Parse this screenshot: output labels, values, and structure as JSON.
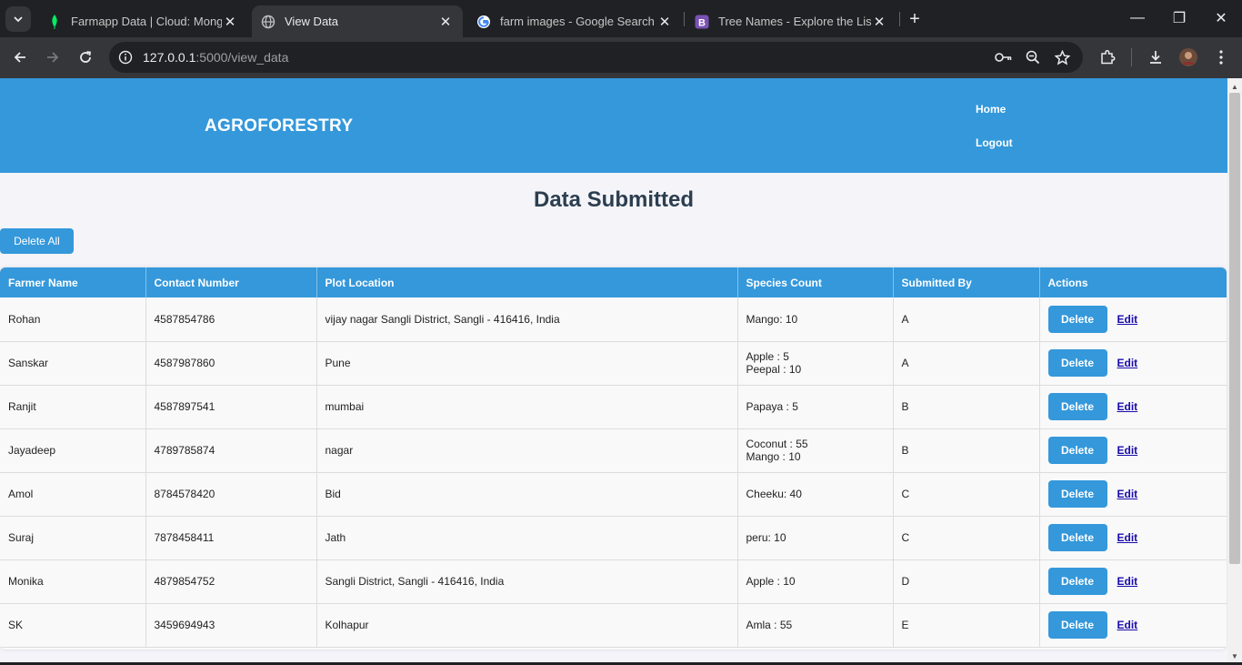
{
  "browser": {
    "tabs": [
      {
        "title": "Farmapp Data | Cloud: MongoDB",
        "icon": "mongodb-leaf-icon",
        "active": false
      },
      {
        "title": "View Data",
        "icon": "globe-icon",
        "active": true
      },
      {
        "title": "farm images - Google Search",
        "icon": "google-icon",
        "active": false
      },
      {
        "title": "Tree Names - Explore the List of",
        "icon": "bootstrap-icon",
        "active": false
      }
    ],
    "url_host": "127.0.0.1",
    "url_path": ":5000/view_data",
    "close_glyph": "✕",
    "new_tab_glyph": "+",
    "window": {
      "minimize": "—",
      "restore": "❐",
      "close": "✕"
    }
  },
  "site": {
    "brand": "AGROFORESTRY",
    "nav": [
      "Home",
      "Logout"
    ],
    "title": "Data Submitted",
    "delete_all_label": "Delete All",
    "columns": [
      "Farmer Name",
      "Contact Number",
      "Plot Location",
      "Species Count",
      "Submitted By",
      "Actions"
    ],
    "rows": [
      {
        "farmer": "Rohan",
        "contact": "4587854786",
        "location": "vijay nagar Sangli District, Sangli - 416416, India",
        "species": [
          "Mango: 10"
        ],
        "by": "A"
      },
      {
        "farmer": "Sanskar",
        "contact": "4587987860",
        "location": "Pune",
        "species": [
          "Apple : 5",
          "Peepal : 10"
        ],
        "by": "A"
      },
      {
        "farmer": "Ranjit",
        "contact": "4587897541",
        "location": "mumbai",
        "species": [
          "Papaya : 5"
        ],
        "by": "B"
      },
      {
        "farmer": "Jayadeep",
        "contact": "4789785874",
        "location": "nagar",
        "species": [
          "Coconut : 55",
          "Mango : 10"
        ],
        "by": "B"
      },
      {
        "farmer": "Amol",
        "contact": "8784578420",
        "location": "Bid",
        "species": [
          "Cheeku: 40"
        ],
        "by": "C"
      },
      {
        "farmer": "Suraj",
        "contact": "7878458411",
        "location": "Jath",
        "species": [
          "peru: 10"
        ],
        "by": "C"
      },
      {
        "farmer": "Monika",
        "contact": "4879854752",
        "location": "Sangli District, Sangli - 416416, India",
        "species": [
          "Apple : 10"
        ],
        "by": "D"
      },
      {
        "farmer": "SK",
        "contact": "3459694943",
        "location": "Kolhapur",
        "species": [
          "Amla : 55"
        ],
        "by": "E"
      }
    ],
    "delete_label": "Delete",
    "edit_label": "Edit"
  },
  "colors": {
    "accent": "#3498db",
    "heading": "#2c3e50",
    "browser_dark": "#202124",
    "browser_tab": "#35363a"
  }
}
